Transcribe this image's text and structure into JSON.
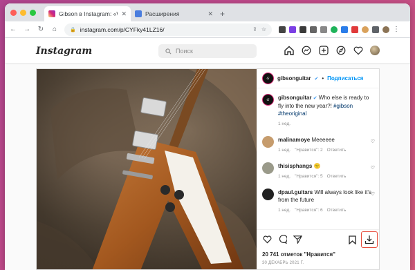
{
  "browser": {
    "tabs": [
      {
        "label": "Gibson в Instagram: «Who else",
        "active": true
      },
      {
        "label": "Расширения",
        "active": false
      }
    ],
    "new_tab": "+",
    "url": "instagram.com/p/CYFky41LZ16/"
  },
  "instagram": {
    "logo": "Instagram",
    "search_placeholder": "Поиск"
  },
  "post": {
    "author": "gibsonguitar",
    "follow_label": "Подписаться",
    "caption_text": "Who else is ready to fly into the new year?!",
    "caption_tags": "#gibson #theoriginal",
    "caption_age": "1 нед.",
    "comments": [
      {
        "user": "malinamoye",
        "text": "Meeeeee",
        "age": "1 нед.",
        "likes": "\"Нравится\": 2",
        "reply": "Ответить"
      },
      {
        "user": "thisisphangs",
        "text": "🙂",
        "age": "1 нед.",
        "likes": "\"Нравится\": 5",
        "reply": "Ответить"
      },
      {
        "user": "dpaul.guitars",
        "text": "Will always look like it's from the future",
        "age": "1 нед.",
        "likes": "\"Нравится\": 6",
        "reply": "Ответить"
      }
    ],
    "likes_count": "20 741 отметок \"Нравится\"",
    "date": "30 ДЕКАБРЬ 2021 Г."
  },
  "colors": {
    "accent": "#0095f6",
    "download_highlight": "#e74c3c"
  }
}
